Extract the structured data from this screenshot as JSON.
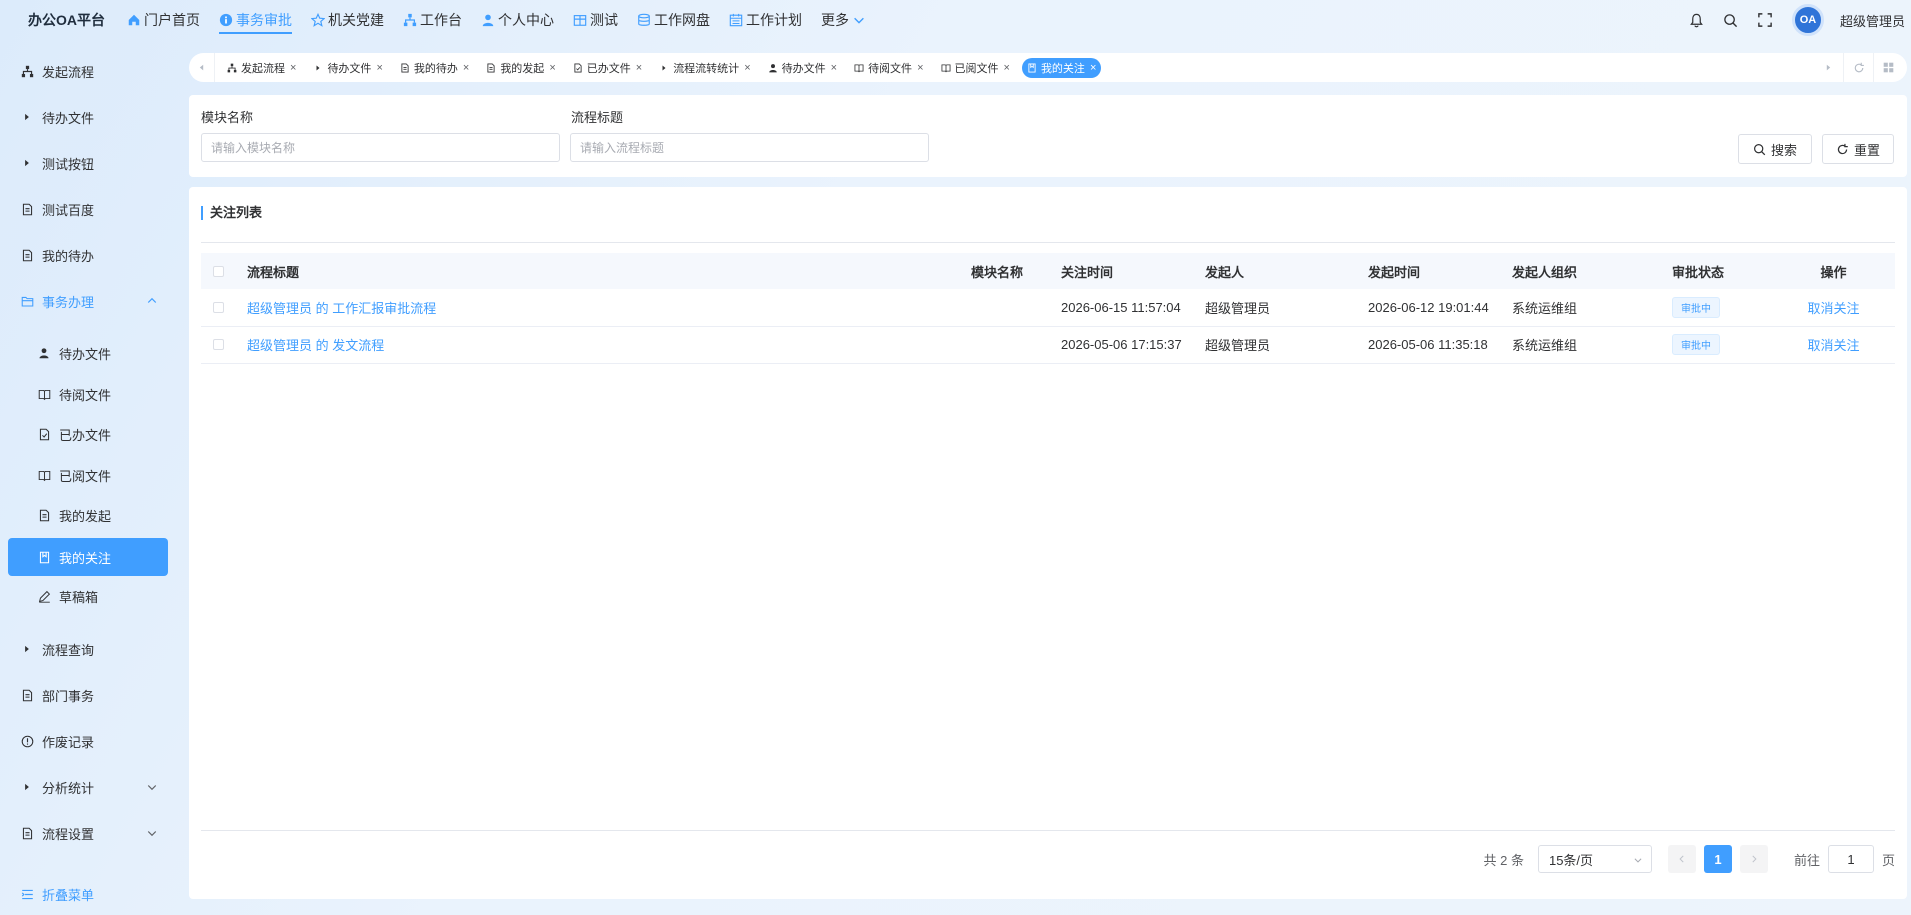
{
  "app": {
    "brand": "办公OA平台"
  },
  "topnav": {
    "items": [
      {
        "label": "门户首页",
        "icon": "home-icon"
      },
      {
        "label": "事务审批",
        "icon": "info-circle-icon",
        "active": true
      },
      {
        "label": "机关党建",
        "icon": "star-icon"
      },
      {
        "label": "工作台",
        "icon": "org-tree-icon"
      },
      {
        "label": "个人中心",
        "icon": "user-icon"
      },
      {
        "label": "测试",
        "icon": "grid-box-icon"
      },
      {
        "label": "工作网盘",
        "icon": "database-icon"
      },
      {
        "label": "工作计划",
        "icon": "calendar-icon"
      },
      {
        "label": "更多",
        "icon": "chevron-down-icon"
      }
    ],
    "avatar_text": "OA",
    "username": "超级管理员"
  },
  "sidebar": {
    "items": [
      {
        "label": "发起流程",
        "icon": "org-tree-icon"
      },
      {
        "label": "待办文件",
        "icon": "caret-right-icon"
      },
      {
        "label": "测试按钮",
        "icon": "caret-right-icon"
      },
      {
        "label": "测试百度",
        "icon": "document-icon"
      },
      {
        "label": "我的待办",
        "icon": "document-icon"
      },
      {
        "label": "事务办理",
        "icon": "folder-open-icon"
      },
      {
        "label": "待办文件",
        "icon": "user-icon"
      },
      {
        "label": "待阅文件",
        "icon": "book-icon"
      },
      {
        "label": "已办文件",
        "icon": "document-check-icon"
      },
      {
        "label": "已阅文件",
        "icon": "book-icon"
      },
      {
        "label": "我的发起",
        "icon": "document-icon"
      },
      {
        "label": "我的关注",
        "icon": "bookmark-icon"
      },
      {
        "label": "草稿箱",
        "icon": "edit-icon"
      },
      {
        "label": "流程查询",
        "icon": "caret-right-icon"
      },
      {
        "label": "部门事务",
        "icon": "document-icon"
      },
      {
        "label": "作废记录",
        "icon": "warning-circle-icon"
      },
      {
        "label": "分析统计",
        "icon": "caret-right-icon"
      },
      {
        "label": "流程设置",
        "icon": "document-icon"
      }
    ],
    "collapse_label": "折叠菜单"
  },
  "tabs": [
    {
      "label": "发起流程",
      "icon": "org-tree-icon"
    },
    {
      "label": "待办文件",
      "icon": "caret-right-icon"
    },
    {
      "label": "我的待办",
      "icon": "document-icon"
    },
    {
      "label": "我的发起",
      "icon": "document-icon"
    },
    {
      "label": "已办文件",
      "icon": "document-check-icon"
    },
    {
      "label": "流程流转统计",
      "icon": "caret-right-icon"
    },
    {
      "label": "待办文件",
      "icon": "user-icon"
    },
    {
      "label": "待阅文件",
      "icon": "book-icon"
    },
    {
      "label": "已阅文件",
      "icon": "book-icon"
    },
    {
      "label": "我的关注",
      "icon": "bookmark-icon",
      "active": true
    }
  ],
  "search": {
    "module_label": "模块名称",
    "module_placeholder": "请输入模块名称",
    "title_label": "流程标题",
    "title_placeholder": "请输入流程标题",
    "search_button": "搜索",
    "reset_button": "重置"
  },
  "list": {
    "title": "关注列表",
    "columns": [
      "流程标题",
      "模块名称",
      "关注时间",
      "发起人",
      "发起时间",
      "发起人组织",
      "审批状态",
      "操作"
    ],
    "rows": [
      {
        "title": "超级管理员 的 工作汇报审批流程",
        "module": "",
        "follow_time": "2026-06-15 11:57:04",
        "initiator": "超级管理员",
        "start_time": "2026-06-12 19:01:44",
        "org": "系统运维组",
        "status": "审批中",
        "action": "取消关注"
      },
      {
        "title": "超级管理员 的 发文流程",
        "module": "",
        "follow_time": "2026-05-06 17:15:37",
        "initiator": "超级管理员",
        "start_time": "2026-05-06 11:35:18",
        "org": "系统运维组",
        "status": "审批中",
        "action": "取消关注"
      }
    ]
  },
  "pagination": {
    "total": "共 2 条",
    "page_size": "15条/页",
    "current_page": "1",
    "goto_label": "前往",
    "goto_value": "1",
    "page_unit": "页"
  },
  "colors": {
    "accent": "#409eff",
    "text": "#303133",
    "border": "#dcdfe6"
  }
}
